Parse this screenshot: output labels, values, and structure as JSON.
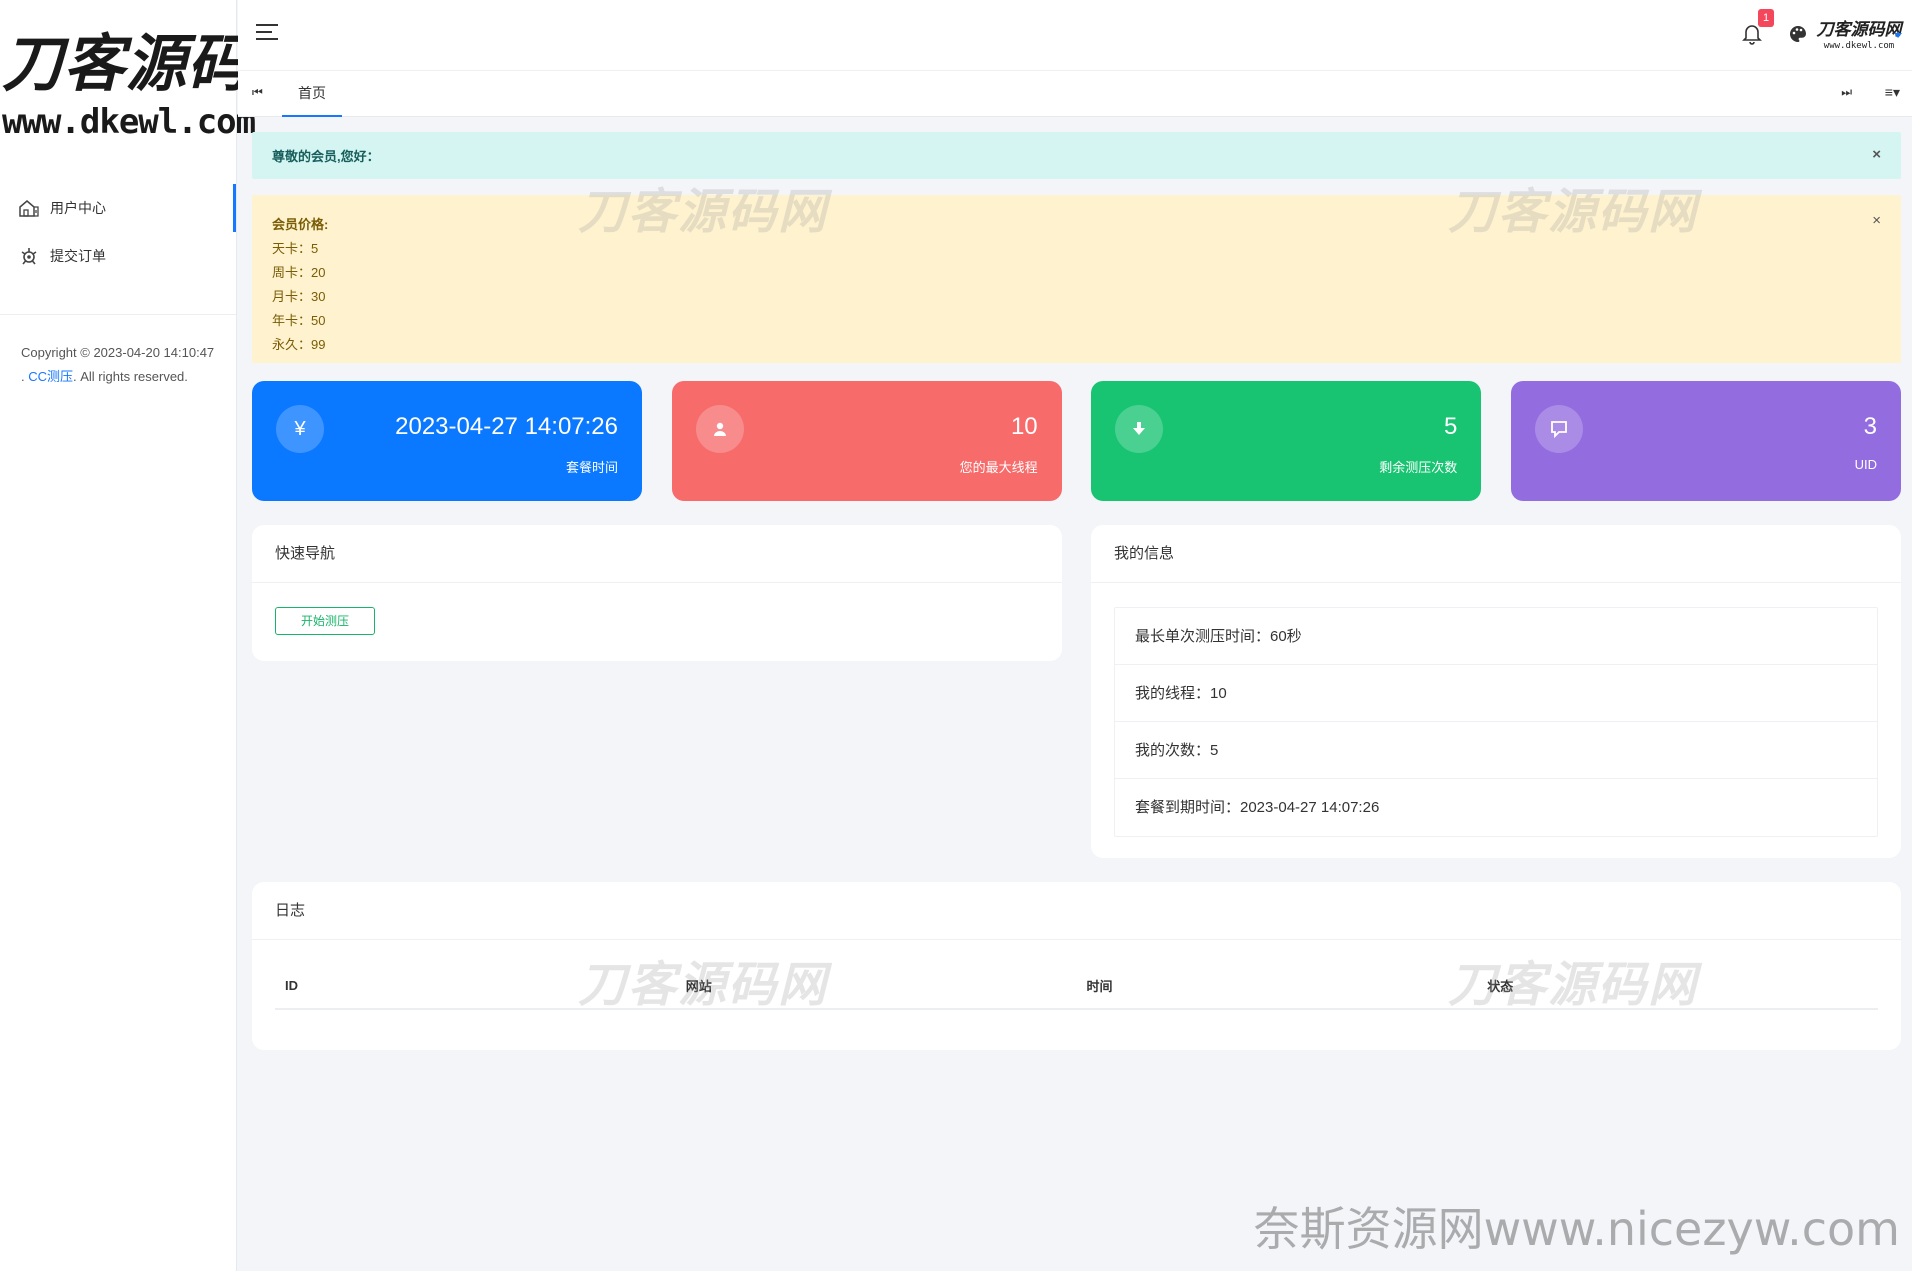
{
  "logo": {
    "title": "刀客源码网",
    "url": "www.dkewl.com"
  },
  "sidebar": {
    "items": [
      {
        "label": "用户中心",
        "icon": "home-icon"
      },
      {
        "label": "提交订单",
        "icon": "gear-icon"
      }
    ],
    "copyright": {
      "prefix": "Copyright © 2023-04-20 14:10:47 . ",
      "link": "CC测压",
      "suffix": ". All rights reserved."
    }
  },
  "header": {
    "notification_count": "1",
    "avatar_title": "刀客源码网",
    "avatar_url": "www.dkewl.com"
  },
  "tabs": {
    "home": "首页"
  },
  "alerts": {
    "greeting": "尊敬的会员,您好：",
    "price_title": "会员价格:",
    "prices": [
      "天卡：5",
      "周卡：20",
      "月卡：30",
      "年卡：50",
      "永久：99"
    ],
    "close": "×"
  },
  "stats": [
    {
      "value": "2023-04-27 14:07:26",
      "label": "套餐时间",
      "icon": "yen-icon",
      "color": "#0a78ff"
    },
    {
      "value": "10",
      "label": "您的最大线程",
      "icon": "user-icon",
      "color": "#f76b6b"
    },
    {
      "value": "5",
      "label": "剩余测压次数",
      "icon": "download-icon",
      "color": "#18c472"
    },
    {
      "value": "3",
      "label": "UID",
      "icon": "chat-icon",
      "color": "#936ce0"
    }
  ],
  "quick_nav": {
    "title": "快速导航",
    "button": "开始测压"
  },
  "my_info": {
    "title": "我的信息",
    "items": [
      "最长单次测压时间：60秒",
      "我的线程：10",
      "我的次数：5",
      "套餐到期时间：2023-04-27 14:07:26"
    ]
  },
  "log": {
    "title": "日志",
    "columns": [
      "ID",
      "网站",
      "时间",
      "状态"
    ]
  },
  "watermark": {
    "text": "刀客源码网",
    "bottom": "奈斯资源网www.nicezyw.com"
  }
}
